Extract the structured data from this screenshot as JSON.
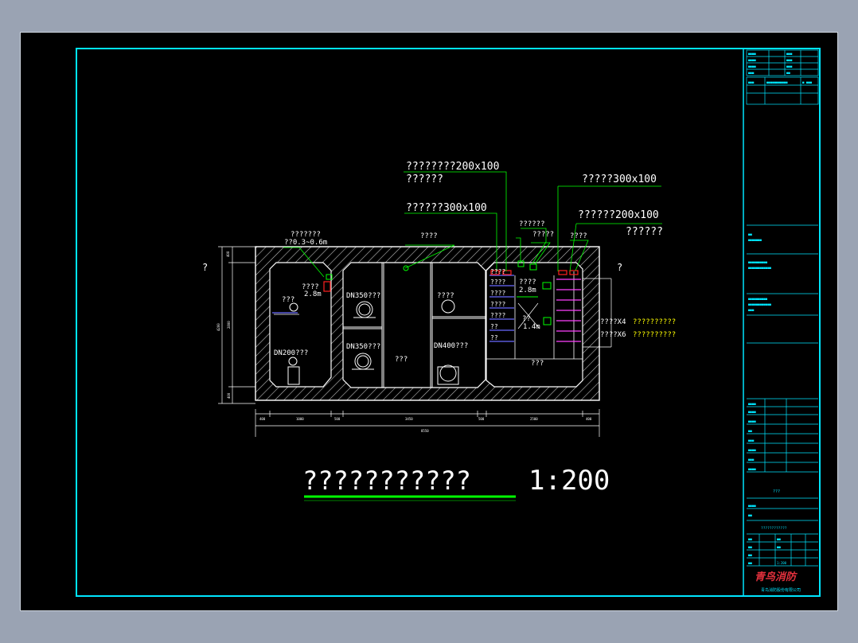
{
  "colors": {
    "frame": "#00e5ff",
    "wall": "#ffffff",
    "green": "#00ff00",
    "red": "#ff2020",
    "blue": "#6a6aff",
    "magenta": "#ff40ff",
    "yellow": "#ffff00",
    "background": "#000000",
    "outer": "#9aa3b3"
  },
  "callouts": {
    "c1_l1": "????????200x100",
    "c1_l2": "??????",
    "c2": "??????300x100",
    "c3": "?????300x100",
    "c4_l1": "??????200x100",
    "c4_l2": "??????",
    "small_a1": "???????",
    "small_a2": "??0.3~0.6m",
    "small_b": "????",
    "small_c": "??????",
    "small_d": "?????",
    "small_e": "????"
  },
  "section": {
    "left_mark": "?",
    "right_mark": "?",
    "room1_label": "???",
    "room1_h_label": "????",
    "room1_h_value": "2.8m",
    "room1_pipe": "DN200???",
    "pipe_dn350_a": "DN350???",
    "pipe_dn350_b": "DN350???",
    "center_label": "???",
    "room3_label": "????",
    "pipe_dn400": "DN400???",
    "tray_labels": [
      "????",
      "????",
      "????",
      "????",
      "????",
      "??",
      "??"
    ],
    "mid_h_label": "????",
    "mid_h_value": "2.8m",
    "mid_h2_label": "??",
    "mid_h2_value": "1.4m",
    "bottom_label": "???",
    "note_x4_a": "????X4",
    "note_x4_b": "??????????",
    "note_x6_a": "????X6",
    "note_x6_b": "??????????"
  },
  "dimensions": {
    "vertical": [
      "400",
      "4200",
      "2800",
      "400"
    ],
    "horizontal": [
      "400",
      "1000",
      "500",
      "3450",
      "500",
      "2500",
      "400"
    ],
    "total": "8550"
  },
  "drawing_title": {
    "text": "???????????",
    "scale": "1:200"
  },
  "title_block": {
    "project": "???",
    "drawing_name": "????????????",
    "scale_value": "1:200",
    "company_logo": "青鸟消防",
    "company_name": "青鸟消防股份有限公司"
  }
}
